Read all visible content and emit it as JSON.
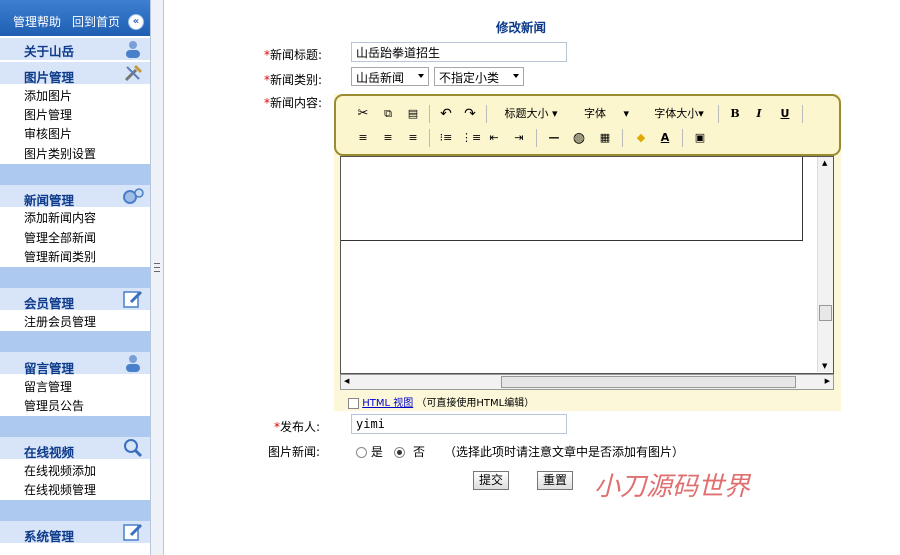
{
  "sidebar": {
    "top_links": [
      "管理帮助",
      "回到首页"
    ],
    "collapse_label": "«",
    "sections": [
      {
        "title": "关于山岳",
        "icon": "person-icon",
        "items": []
      },
      {
        "title": "图片管理",
        "icon": "tools-icon",
        "items": [
          "添加图片",
          "图片管理",
          "审核图片",
          "图片类别设置"
        ]
      },
      {
        "title": "新闻管理",
        "icon": "gears-icon",
        "items": [
          "添加新闻内容",
          "管理全部新闻",
          "管理新闻类别"
        ]
      },
      {
        "title": "会员管理",
        "icon": "edit-icon",
        "items": [
          "注册会员管理"
        ]
      },
      {
        "title": "留言管理",
        "icon": "person-icon",
        "items": [
          "留言管理",
          "管理员公告"
        ]
      },
      {
        "title": "在线视频",
        "icon": "search-icon",
        "items": [
          "在线视频添加",
          "在线视频管理"
        ]
      },
      {
        "title": "系统管理",
        "icon": "edit-icon",
        "items": []
      }
    ]
  },
  "form": {
    "page_title": "修改新闻",
    "required_mark": "*",
    "title_label": "新闻标题:",
    "title_value": "山岳跆拳道招生",
    "category_label": "新闻类别:",
    "category_value": "山岳新闻",
    "subcategory_value": "不指定小类",
    "content_label": "新闻内容:",
    "author_label": "发布人:",
    "author_value": "yimi",
    "image_news_label": "图片新闻:",
    "radio_yes": "是",
    "radio_no": "否",
    "image_news_selected": "否",
    "image_news_hint": "（选择此项时请注意文章中是否添加有图片）",
    "submit_label": "提交",
    "reset_label": "重置"
  },
  "editor": {
    "heading_label": "标题大小",
    "font_label": "字体",
    "font_size_label": "字体大小",
    "bold": "B",
    "italic": "I",
    "underline": "U",
    "html_view_label": "HTML 视图",
    "html_view_hint": "（可直接使用HTML编辑）"
  },
  "watermark": "小刀源码世界",
  "colors": {
    "sidebar_header": "#2a64b8",
    "section_bg": "#d8e4f8",
    "section_gap": "#aec9ef",
    "title": "#0f3c8a",
    "toolbar_border": "#9a8a30"
  }
}
